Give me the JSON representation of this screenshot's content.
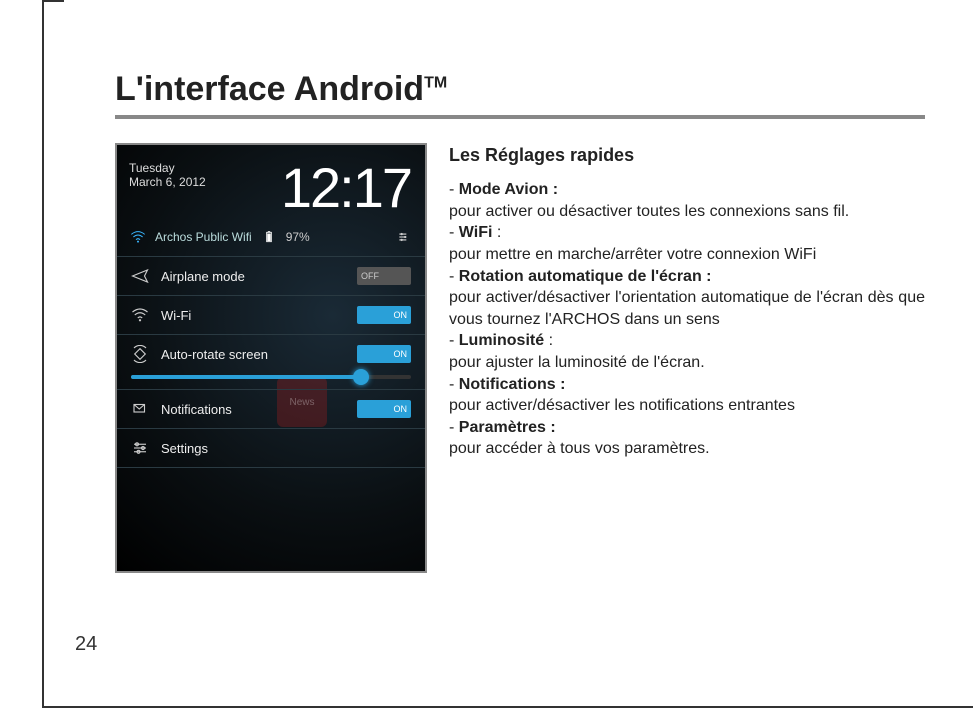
{
  "page": {
    "title_main": "L'interface Android",
    "title_tm": "TM",
    "number": "24"
  },
  "screenshot": {
    "date_day": "Tuesday",
    "date_full": "March 6, 2012",
    "clock": "12:17",
    "wifi_name": "Archos Public Wifi",
    "battery": "97%",
    "items": [
      {
        "label": "Airplane mode",
        "toggle": "OFF",
        "state": "off"
      },
      {
        "label": "Wi-Fi",
        "toggle": "ON",
        "state": "on"
      },
      {
        "label": "Auto-rotate screen",
        "toggle": "ON",
        "state": "on"
      },
      {
        "label": "Notifications",
        "toggle": "ON",
        "state": "on"
      },
      {
        "label": "Settings",
        "toggle": "",
        "state": ""
      }
    ],
    "ghost_app": "News"
  },
  "text": {
    "section_title": "Les Réglages rapides",
    "items": [
      {
        "title": "Mode Avion :",
        "desc": "pour activer ou désactiver toutes les connexions sans fil."
      },
      {
        "title": "WiFi",
        "suffix": " :",
        "desc": "pour mettre en marche/arrêter votre connexion WiFi"
      },
      {
        "title": "Rotation automatique de l'écran :",
        "desc": "pour activer/désactiver l'orientation automatique de l'écran dès que vous tournez l'ARCHOS dans un sens"
      },
      {
        "title": "Luminosité",
        "suffix": " :",
        "desc": "pour ajuster la luminosité de l'écran."
      },
      {
        "title": "Notifications :",
        "desc": "pour activer/désactiver les notifications entrantes"
      },
      {
        "title": "Paramètres :",
        "desc": "pour accéder à tous vos paramètres."
      }
    ]
  }
}
